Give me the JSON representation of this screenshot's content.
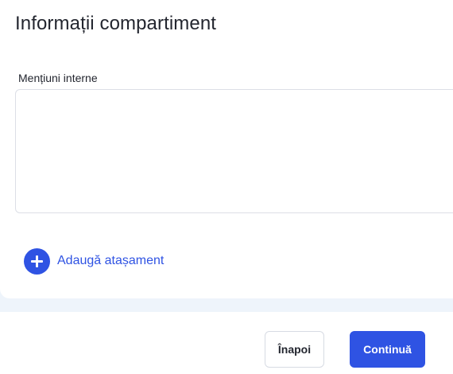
{
  "section": {
    "title": "Informații compartiment"
  },
  "internal_notes": {
    "label": "Mențiuni interne",
    "value": "",
    "placeholder": ""
  },
  "attachment": {
    "add_label": "Adaugă atașament",
    "icon": "plus-circle-icon"
  },
  "footer": {
    "back_label": "Înapoi",
    "continue_label": "Continuă"
  },
  "colors": {
    "accent": "#2f53e3",
    "band": "#eef4fb",
    "border": "#dcdfe6"
  }
}
